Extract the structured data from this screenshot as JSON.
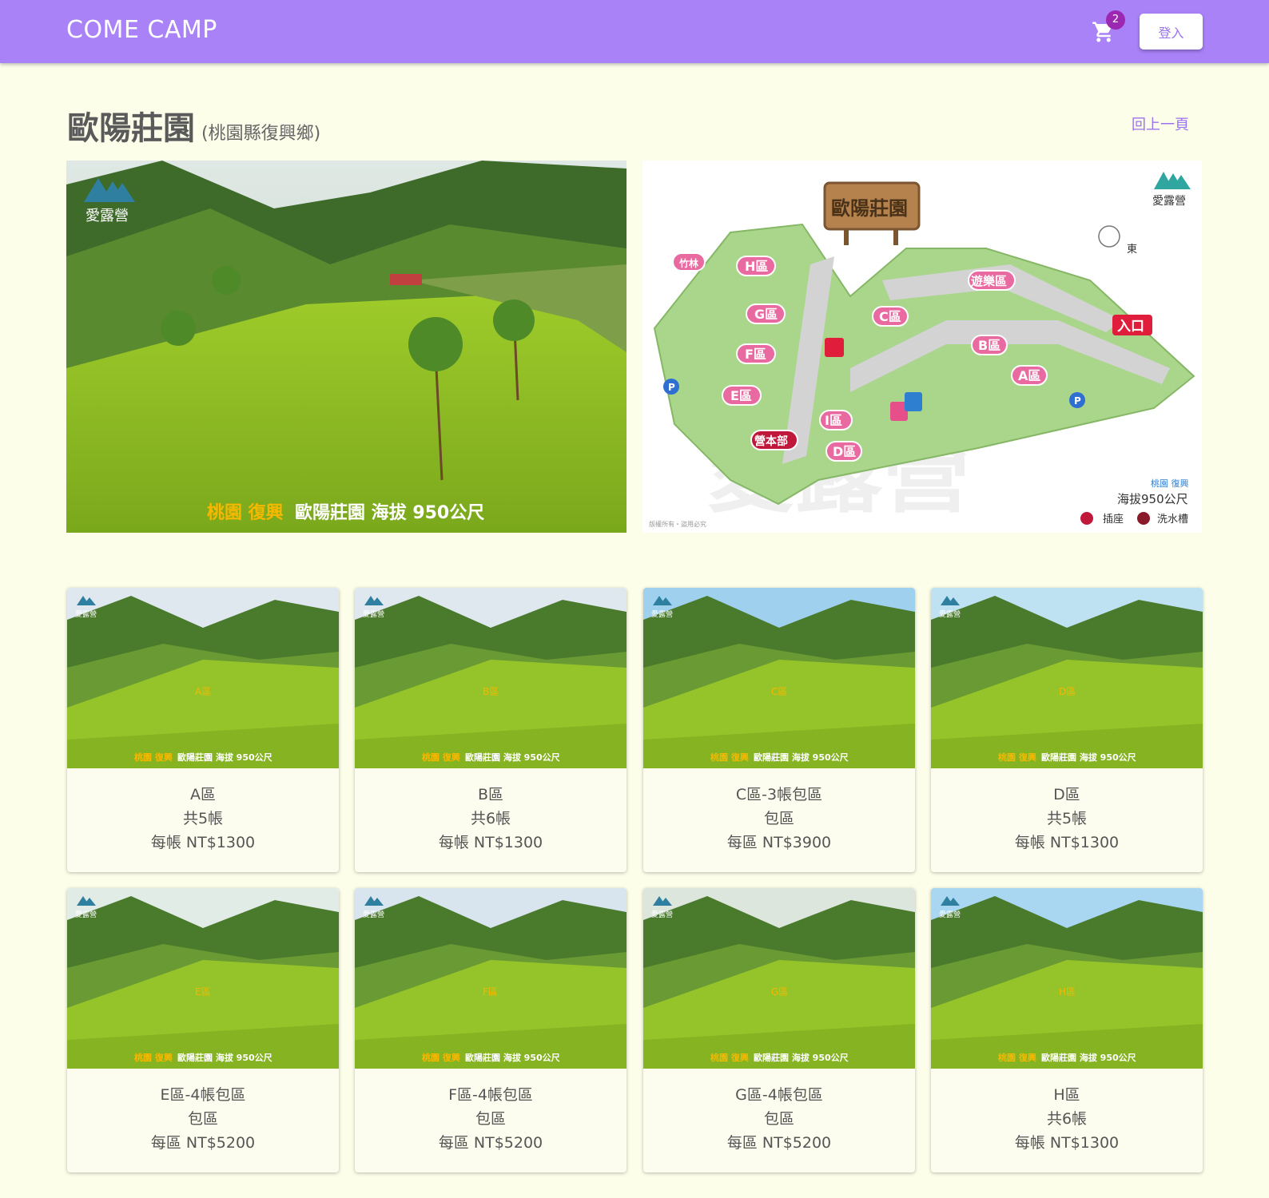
{
  "header": {
    "brand": "COME CAMP",
    "cart_count": "2",
    "login_label": "登入"
  },
  "page": {
    "title": "歐陽莊園",
    "location": "(桃園縣復興鄉)",
    "back_label": "回上一頁"
  },
  "hero": {
    "photo": {
      "watermark": "愛露營",
      "caption_a": "桃園 復興",
      "caption_b": "歐陽莊園 海拔 950公尺"
    },
    "map": {
      "sign": "歐陽莊園",
      "watermark": "愛露營",
      "big_watermark": "愛露營",
      "zones": [
        "H區",
        "G區",
        "F區",
        "E區",
        "I區",
        "D區",
        "C區",
        "B區",
        "A區"
      ],
      "labels": {
        "bamboo": "竹林",
        "playground": "遊樂區",
        "entrance": "入口",
        "hq": "營本部",
        "east": "東",
        "region": "桃園 復興",
        "altitude": "海拔950公尺",
        "outlet": "插座",
        "sink": "洗水槽",
        "copyright": "版權所有・盜用必究"
      }
    }
  },
  "cards": [
    {
      "zone": "A區",
      "name": "A區",
      "detail": "共5帳",
      "price": "每帳 NT$1300"
    },
    {
      "zone": "B區",
      "name": "B區",
      "detail": "共6帳",
      "price": "每帳 NT$1300"
    },
    {
      "zone": "C區",
      "name": "C區-3帳包區",
      "detail": "包區",
      "price": "每區 NT$3900"
    },
    {
      "zone": "D區",
      "name": "D區",
      "detail": "共5帳",
      "price": "每帳 NT$1300"
    },
    {
      "zone": "E區",
      "name": "E區-4帳包區",
      "detail": "包區",
      "price": "每區 NT$5200"
    },
    {
      "zone": "F區",
      "name": "F區-4帳包區",
      "detail": "包區",
      "price": "每區 NT$5200"
    },
    {
      "zone": "G區",
      "name": "G區-4帳包區",
      "detail": "包區",
      "price": "每區 NT$5200"
    },
    {
      "zone": "H區",
      "name": "H區",
      "detail": "共6帳",
      "price": "每帳 NT$1300"
    }
  ],
  "card_caption": {
    "watermark": "愛露營",
    "caption_a": "桃園 復興",
    "caption_b": "歐陽莊園 海拔 950公尺"
  },
  "colors": {
    "header": "#a982f8",
    "background": "#fdfeea",
    "accent": "#9a72f0",
    "badge": "#9c27b0",
    "grass": "#8fbf2a",
    "zone_pill": "#e96aa0"
  },
  "icons": {
    "cart": "shopping-cart-icon"
  }
}
